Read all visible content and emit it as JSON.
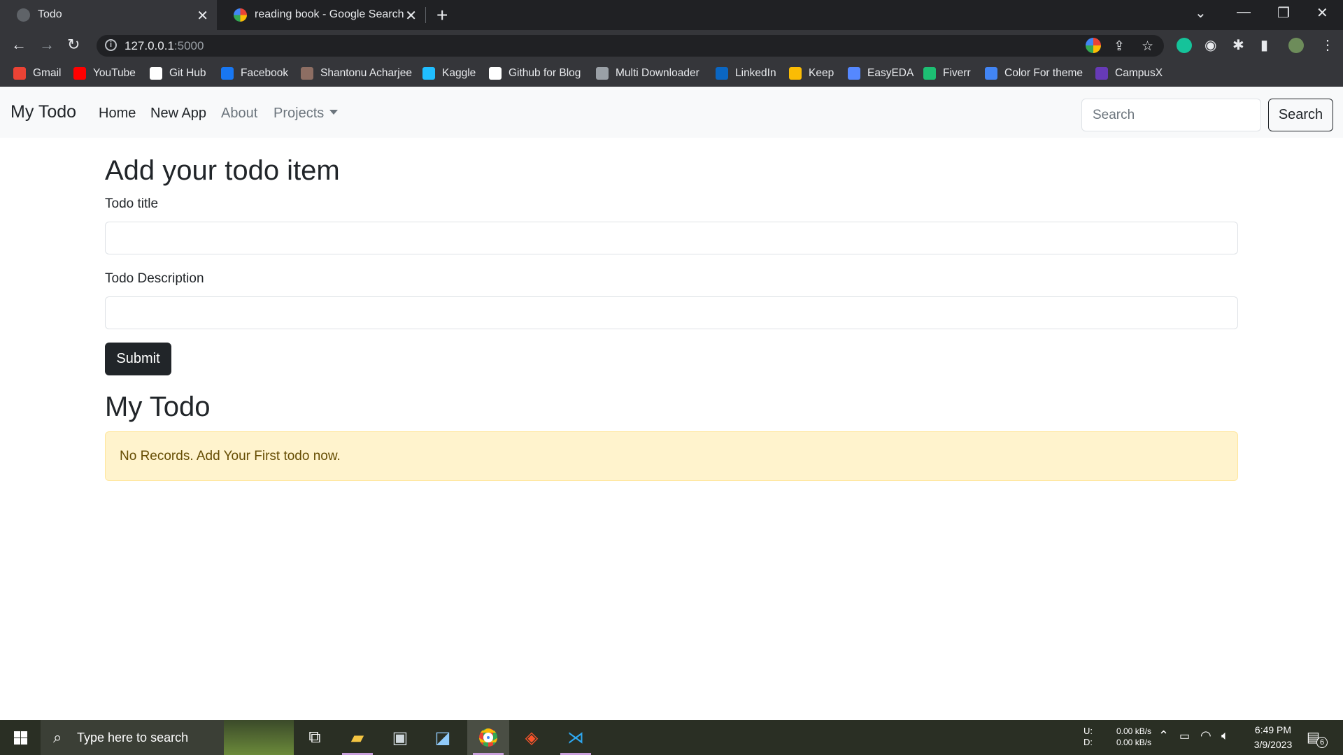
{
  "browser": {
    "tabs": [
      {
        "title": "Todo",
        "active": true
      },
      {
        "title": "reading book - Google Search",
        "active": false
      }
    ],
    "url_host": "127.0.0.1",
    "url_port": ":5000",
    "bookmarks": [
      {
        "label": "Gmail",
        "icon": "gmail-icon",
        "color": "#ea4335"
      },
      {
        "label": "YouTube",
        "icon": "youtube-icon",
        "color": "#ff0000"
      },
      {
        "label": "Git Hub",
        "icon": "github-icon",
        "color": "#ffffff"
      },
      {
        "label": "Facebook",
        "icon": "facebook-icon",
        "color": "#1877f2"
      },
      {
        "label": "Shantonu Acharjee",
        "icon": "profile-icon",
        "color": "#8d6e63"
      },
      {
        "label": "Kaggle",
        "icon": "kaggle-icon",
        "color": "#20beff"
      },
      {
        "label": "Github for Blog",
        "icon": "code-icon",
        "color": "#ffffff"
      },
      {
        "label": "Multi Downloader",
        "icon": "globe-icon",
        "color": "#9aa0a6"
      },
      {
        "label": "LinkedIn",
        "icon": "linkedin-icon",
        "color": "#0a66c2"
      },
      {
        "label": "Keep",
        "icon": "keep-icon",
        "color": "#fbbc04"
      },
      {
        "label": "EasyEDA",
        "icon": "easyeda-icon",
        "color": "#5588ff"
      },
      {
        "label": "Fiverr",
        "icon": "fiverr-icon",
        "color": "#1dbf73"
      },
      {
        "label": "Color For theme",
        "icon": "color-icon",
        "color": "#4285f4"
      },
      {
        "label": "CampusX",
        "icon": "campusx-icon",
        "color": "#673ab7"
      }
    ]
  },
  "navbar": {
    "brand": "My Todo",
    "links": [
      {
        "label": "Home",
        "style": "dark"
      },
      {
        "label": "New App",
        "style": "dark"
      },
      {
        "label": "About",
        "style": "muted"
      },
      {
        "label": "Projects",
        "style": "muted",
        "dropdown": true
      }
    ],
    "search_placeholder": "Search",
    "search_button": "Search"
  },
  "form": {
    "heading": "Add your todo item",
    "title_label": "Todo title",
    "title_value": "",
    "desc_label": "Todo Description",
    "desc_value": "",
    "submit_label": "Submit"
  },
  "list": {
    "heading": "My Todo",
    "empty_message": "No Records. Add Your First todo now."
  },
  "taskbar": {
    "search_placeholder": "Type here to search",
    "net_up_label": "U:",
    "net_down_label": "D:",
    "net_up": "0.00 kB/s",
    "net_down": "0.00 kB/s",
    "time": "6:49 PM",
    "date": "3/9/2023",
    "notifications": "6"
  }
}
